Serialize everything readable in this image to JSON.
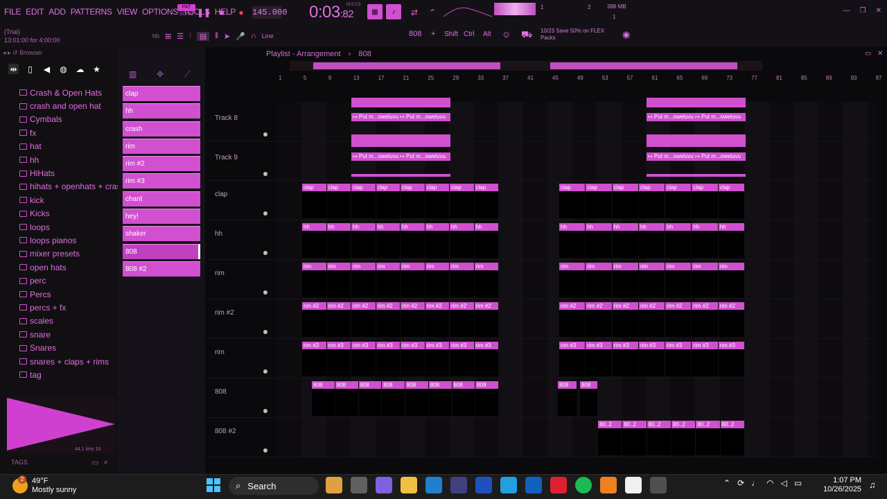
{
  "menu": [
    "FILE",
    "EDIT",
    "ADD",
    "PATTERNS",
    "VIEW",
    "OPTIONS",
    "TOOLS",
    "HELP"
  ],
  "trial": {
    "line1": "(Trial)",
    "line2": "13:01:00 for 4:00:00"
  },
  "patsong": {
    "pat": "PAT",
    "song": "SONG"
  },
  "tempo": "145.000",
  "time": {
    "main": "0:03",
    "frac": ":82",
    "label": "M:S:CS"
  },
  "cpu": {
    "mem": "388 MB",
    "a": "1",
    "b": "2",
    "c": "1"
  },
  "toolbar": {
    "snap": "Line",
    "pattern": "808",
    "shift": "Shift",
    "ctrl": "Ctrl",
    "alt": "Alt",
    "hh": "hh"
  },
  "promo": {
    "count": "10/23",
    "text": "Save 50% on FLEX",
    "text2": "Packs"
  },
  "browser": {
    "title": "Browser"
  },
  "folders": [
    "Crash & Open Hats",
    "crash and open hat",
    "Cymbals",
    "fx",
    "hat",
    "hh",
    "HiHats",
    "hihats + openhats + crashs",
    "kick",
    "Kicks",
    "loops",
    "loops pianos",
    "mixer presets",
    "open hats",
    "perc",
    "Percs",
    "percs + fx",
    "scales",
    "snare",
    "Snares",
    "snares + claps + rims",
    "tag"
  ],
  "wave_info": "44.1 kHz 16",
  "tags_label": "TAGS",
  "channels": [
    "clap",
    "hh",
    "crash",
    "rim",
    "rim #2",
    "rim #3",
    "chant",
    "hey!",
    "shaker",
    "808",
    "808 #2"
  ],
  "playlist": {
    "title": "Playlist - Arrangement",
    "pattern": "808"
  },
  "ruler": [
    "1",
    "5",
    "9",
    "13",
    "17",
    "21",
    "25",
    "29",
    "33",
    "37",
    "41",
    "45",
    "49",
    "53",
    "57",
    "61",
    "65",
    "69",
    "73",
    "77",
    "81",
    "85",
    "89",
    "93",
    "97"
  ],
  "tracks": [
    "Track 8",
    "Track 9",
    "clap",
    "hh",
    "rim",
    "rim #2",
    "rim",
    "808",
    "808 #2"
  ],
  "clip_labels": {
    "audio": "↦ Put m...oweluvu ↦ Put m...oweluvu",
    "clap": "clap",
    "hh": "hh",
    "rim": "rim",
    "rim2": "rim #2",
    "rim3": "rim #3",
    "808": "808",
    "808b": "80..2"
  },
  "taskbar": {
    "temp": "49°F",
    "weather": "Mostly sunny",
    "search": "Search",
    "time": "1:07 PM",
    "date": "10/26/2025",
    "badge": "2"
  }
}
